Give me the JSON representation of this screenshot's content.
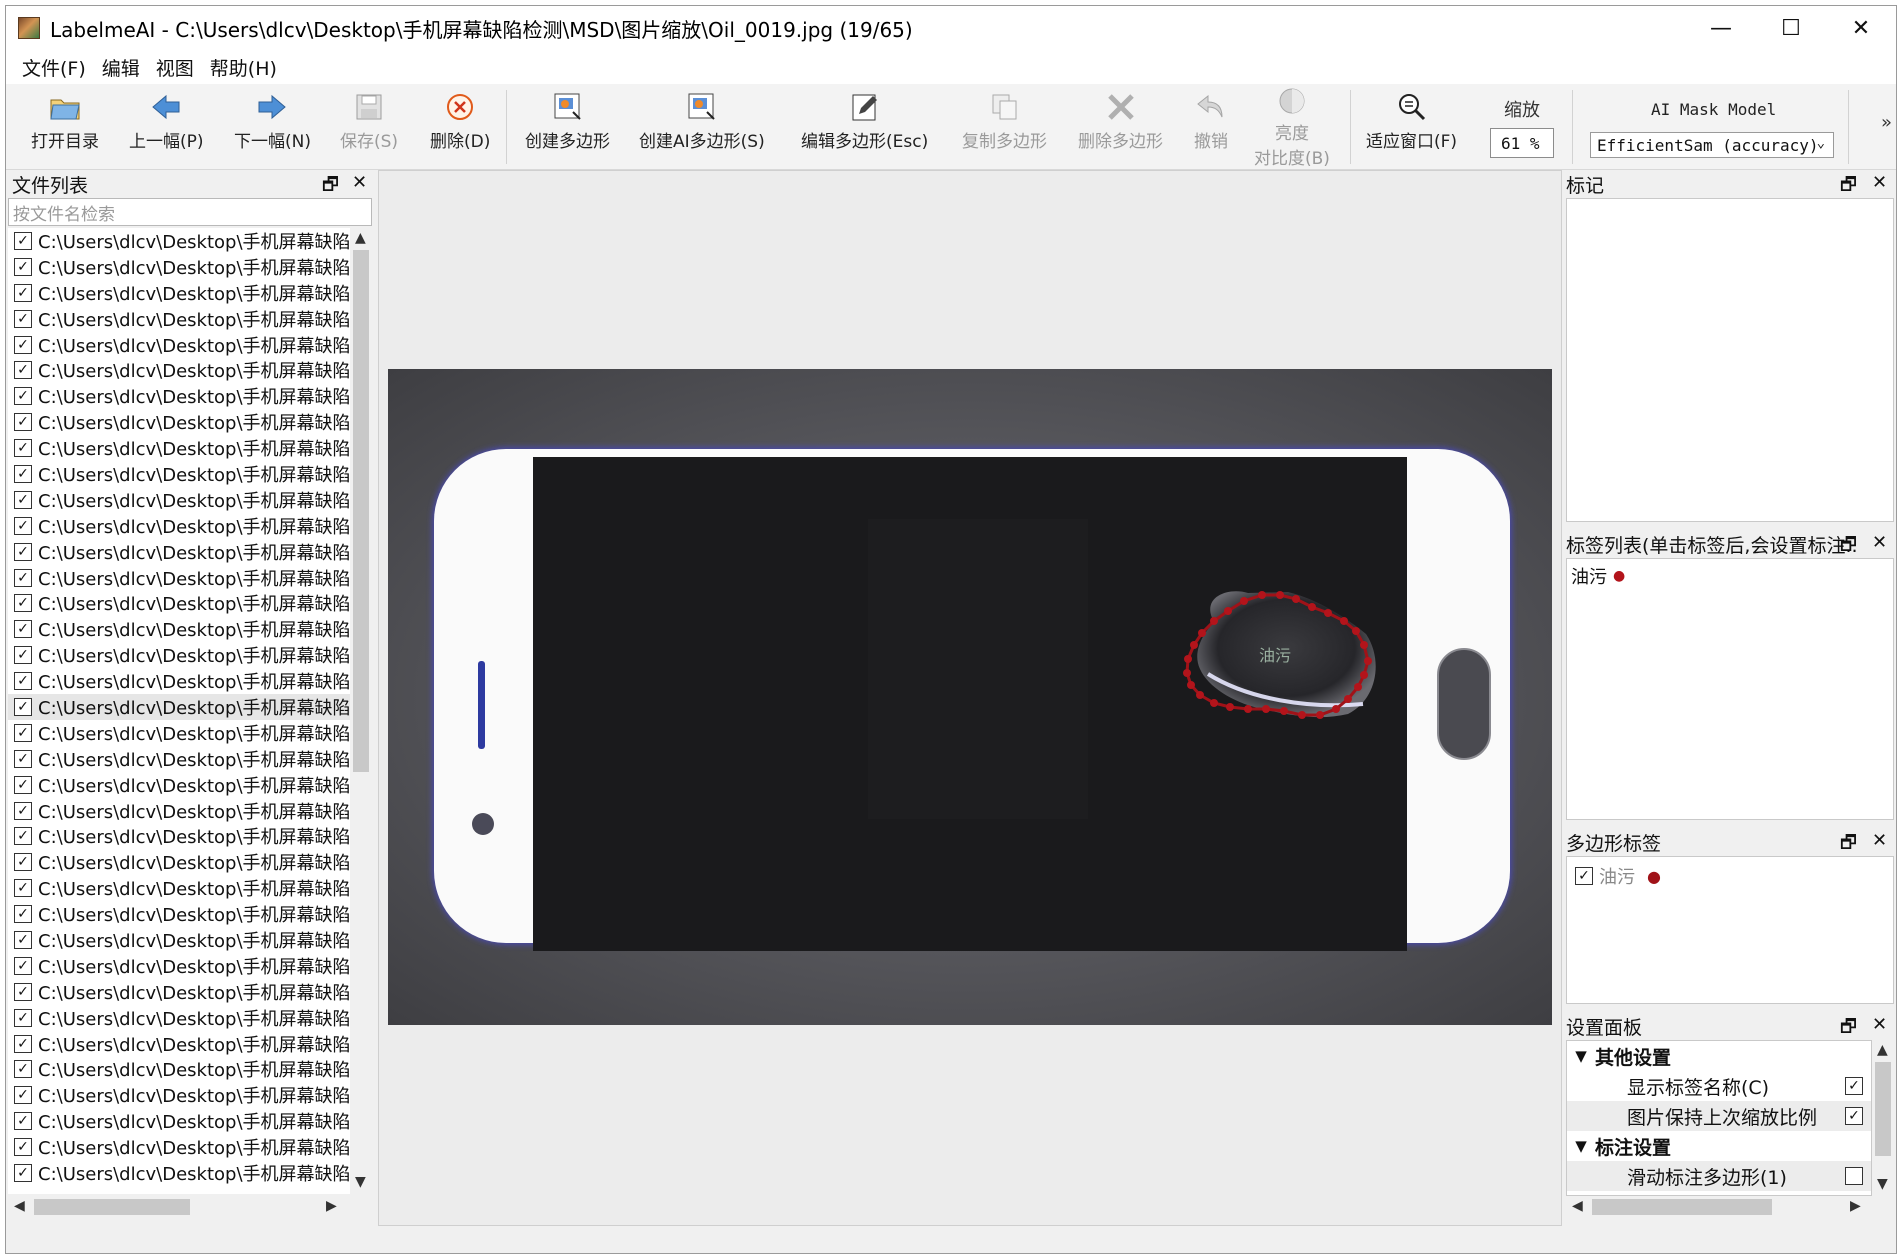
{
  "window": {
    "title": "LabelmeAI - C:\\Users\\dlcv\\Desktop\\手机屏幕缺陷检测\\MSD\\图片缩放\\Oil_0019.jpg (19/65)",
    "minimize": "—",
    "maximize": "☐",
    "close": "✕"
  },
  "menu": [
    "文件(F)",
    "编辑",
    "视图",
    "帮助(H)"
  ],
  "toolbar": {
    "open_dir": "打开目录",
    "prev": "上一幅(P)",
    "next": "下一幅(N)",
    "save": "保存(S)",
    "delete": "删除(D)",
    "create_polygon": "创建多边形",
    "create_ai_polygon": "创建AI多边形(S)",
    "edit_polygon": "编辑多边形(Esc)",
    "copy_polygon": "复制多边形",
    "delete_polygon": "删除多边形",
    "undo": "撤销",
    "brightness_line1": "亮度",
    "brightness_line2": "对比度(B)",
    "fit_window": "适应窗口(F)",
    "zoom_label": "缩放",
    "zoom_value": "61 %",
    "ai_model_label": "AI Mask Model",
    "ai_model_value": "EfficientSam (accuracy)",
    "more": "»"
  },
  "file_panel": {
    "title": "文件列表",
    "search_placeholder": "按文件名检索",
    "item_text": "C:\\Users\\dlcv\\Desktop\\手机屏幕缺陷",
    "selected_index": 18
  },
  "panels": {
    "flags_title": "标记",
    "label_list_title": "标签列表(单击标签后,会设置标注..",
    "label_list_items": [
      "油污"
    ],
    "polygon_labels_title": "多边形标签",
    "polygon_labels_items": [
      "油污"
    ],
    "settings_title": "设置面板",
    "settings": {
      "group1": "其他设置",
      "show_label_name": "显示标签名称(C)",
      "keep_zoom": "图片保持上次缩放比例",
      "group2": "标注设置",
      "slide_polygon": "滑动标注多边形(1)"
    }
  },
  "canvas": {
    "shape_label": "油污"
  },
  "colors": {
    "label_dot": "#b3141b",
    "polygon_stroke": "#a01218",
    "phone_body": "#fafafa",
    "screen": "#1a1a1c"
  },
  "icons": {
    "open": "folder-open-icon",
    "prev": "arrow-left-icon",
    "next": "arrow-right-icon",
    "save": "save-icon",
    "delete": "delete-icon",
    "polygon": "create-polygon-icon",
    "ai": "ai-polygon-icon",
    "edit": "edit-icon",
    "copy": "copy-icon",
    "remove": "remove-icon",
    "undo": "undo-icon",
    "brightness": "brightness-icon",
    "fit": "zoom-fit-icon"
  }
}
